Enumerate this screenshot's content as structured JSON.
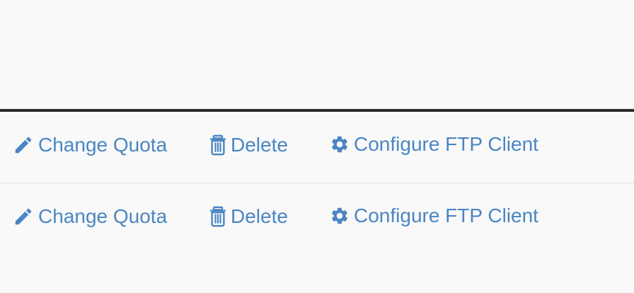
{
  "theme": {
    "link_color": "#4a86c2",
    "header_rule_color": "#2b2b2b",
    "divider_color": "#dcdcdc",
    "background": "#f9f9f9"
  },
  "rows": [
    {
      "actions": {
        "change_quota": {
          "label": "Change Quota",
          "icon": "pencil-icon"
        },
        "delete": {
          "label": "Delete",
          "icon": "trash-icon"
        },
        "configure_ftp": {
          "label": "Configure FTP Client",
          "icon": "gear-icon"
        }
      }
    },
    {
      "actions": {
        "change_quota": {
          "label": "Change Quota",
          "icon": "pencil-icon"
        },
        "delete": {
          "label": "Delete",
          "icon": "trash-icon"
        },
        "configure_ftp": {
          "label": "Configure FTP Client",
          "icon": "gear-icon"
        }
      }
    }
  ]
}
